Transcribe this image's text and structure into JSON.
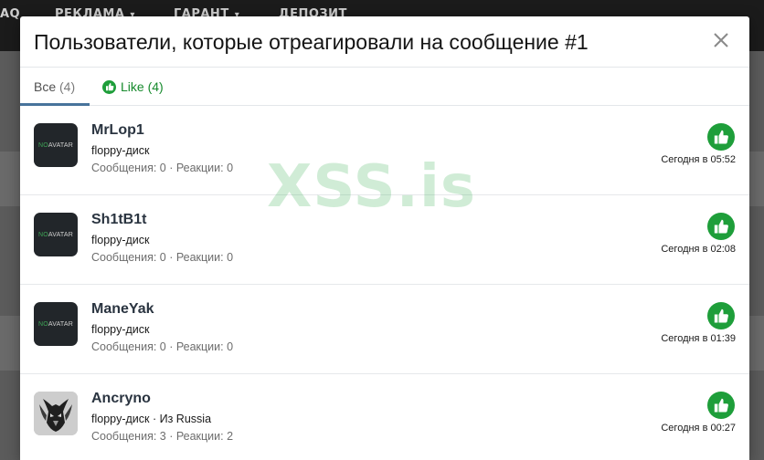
{
  "background": {
    "nav_items": [
      {
        "label": "AQ"
      },
      {
        "label": "РЕКЛАМА"
      },
      {
        "label": "ГАРАНТ"
      },
      {
        "label": "ДЕПОЗИТ"
      }
    ]
  },
  "modal": {
    "title": "Пользователи, которые отреагировали на сообщение #1",
    "close_icon": "close-icon"
  },
  "tabs": {
    "all_label": "Все",
    "all_count": "(4)",
    "like_label": "Like (4)"
  },
  "users": [
    {
      "name": "MrLop1",
      "title": "floppy-диск",
      "stats": "Сообщения: 0 · Реакции: 0",
      "time": "Сегодня в 05:52",
      "avatar": "no-avatar"
    },
    {
      "name": "Sh1tB1t",
      "title": "floppy-диск",
      "stats": "Сообщения: 0 · Реакции: 0",
      "time": "Сегодня в 02:08",
      "avatar": "no-avatar"
    },
    {
      "name": "ManeYak",
      "title": "floppy-диск",
      "stats": "Сообщения: 0 · Реакции: 0",
      "time": "Сегодня в 01:39",
      "avatar": "no-avatar"
    },
    {
      "name": "Ancryno",
      "title": "floppy-диск · Из Russia",
      "stats": "Сообщения: 3 · Реакции: 2",
      "time": "Сегодня в 00:27",
      "avatar": "custom-avatar"
    }
  ],
  "avatar_placeholder": {
    "no": "NO",
    "avatar": "AVATAR"
  },
  "watermark": "XSS.is",
  "colors": {
    "like_green": "#1e9e3a",
    "tab_underline": "#47739b",
    "username": "#2a3440"
  }
}
